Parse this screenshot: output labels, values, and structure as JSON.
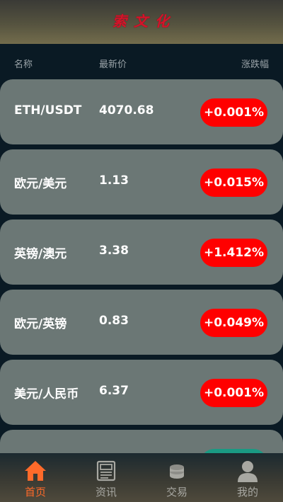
{
  "header": {
    "brand": "索文化"
  },
  "columns": {
    "name": "名称",
    "price": "最新价",
    "change": "涨跌幅"
  },
  "colors": {
    "up": "#ff0000",
    "down": "#1a9a83",
    "active_tab": "#ff6a2a"
  },
  "rows": [
    {
      "name": "ETH/USDT",
      "price": "4070.68",
      "change": "+0.001%"
    },
    {
      "name": "欧元/美元",
      "price": "1.13",
      "change": "+0.015%"
    },
    {
      "name": "英镑/澳元",
      "price": "3.38",
      "change": "+1.412%"
    },
    {
      "name": "欧元/英镑",
      "price": "0.83",
      "change": "+0.049%"
    },
    {
      "name": "美元/人民币",
      "price": "6.37",
      "change": "+0.001%"
    }
  ],
  "tabs": [
    {
      "label": "首页",
      "icon": "home-icon",
      "active": true
    },
    {
      "label": "资讯",
      "icon": "news-icon",
      "active": false
    },
    {
      "label": "交易",
      "icon": "coins-icon",
      "active": false
    },
    {
      "label": "我的",
      "icon": "user-icon",
      "active": false
    }
  ]
}
